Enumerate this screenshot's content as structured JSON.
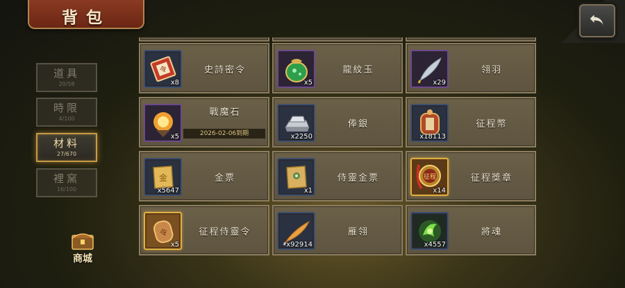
{
  "title": "背包",
  "tabs": [
    {
      "label": "道具",
      "count": "20/58"
    },
    {
      "label": "時限",
      "count": "4/100"
    },
    {
      "label": "材料",
      "count": "27/670"
    },
    {
      "label": "裡窯",
      "count": "16/100"
    }
  ],
  "active_tab": "材料",
  "shop_label": "商城",
  "items": [
    {
      "name": "史詩密令",
      "qty": "x8",
      "icon": "scroll-token-icon",
      "rarity": "blue"
    },
    {
      "name": "龍紋玉",
      "qty": "x5",
      "icon": "jade-pouch-icon",
      "rarity": "purple"
    },
    {
      "name": "翎羽",
      "qty": "x29",
      "icon": "feather-icon",
      "rarity": "purple"
    },
    {
      "name": "戰魔石",
      "qty": "x5",
      "icon": "fire-stone-icon",
      "rarity": "purple",
      "expiry": "2026-02-06到期"
    },
    {
      "name": "俸銀",
      "qty": "x2250",
      "icon": "silver-ingot-icon",
      "rarity": "blue"
    },
    {
      "name": "征程幣",
      "qty": "x18113",
      "icon": "journey-coin-icon",
      "rarity": "blue"
    },
    {
      "name": "金票",
      "qty": "x5647",
      "icon": "gold-ticket-icon",
      "rarity": "blue"
    },
    {
      "name": "侍靈金票",
      "qty": "x1",
      "icon": "spirit-ticket-icon",
      "rarity": "blue"
    },
    {
      "name": "征程獎章",
      "qty": "x14",
      "icon": "journey-medal-icon",
      "rarity": "gold"
    },
    {
      "name": "征程侍靈令",
      "qty": "x5",
      "icon": "spirit-token-icon",
      "rarity": "gold"
    },
    {
      "name": "雁翎",
      "qty": "x92914",
      "icon": "goose-feather-icon",
      "rarity": "blue"
    },
    {
      "name": "將魂",
      "qty": "x4557",
      "icon": "green-soul-icon",
      "rarity": "blue"
    }
  ]
}
